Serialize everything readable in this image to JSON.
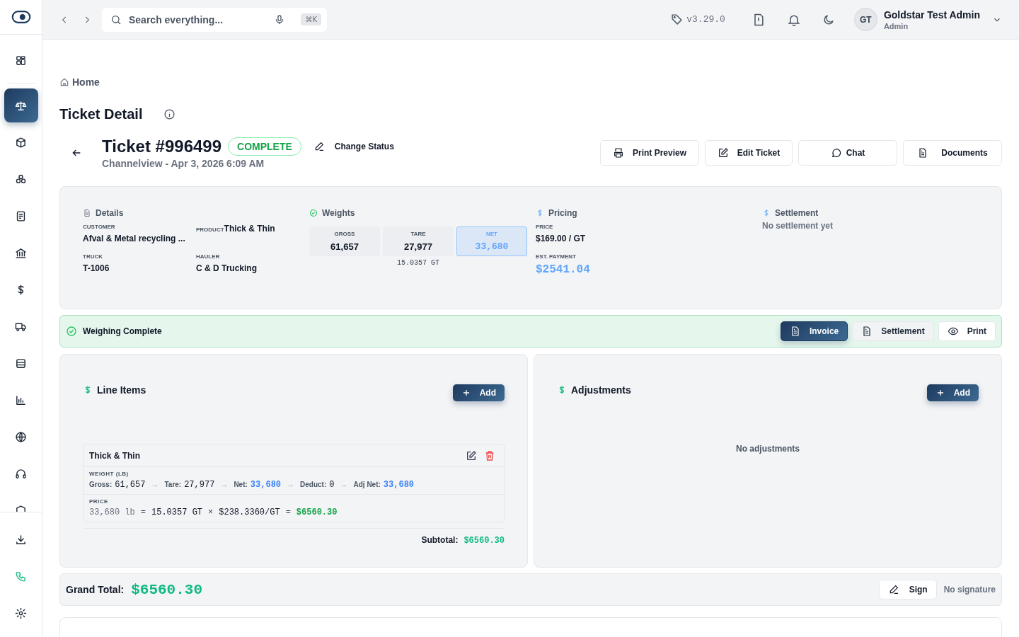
{
  "sidebar": {
    "top_items": [
      {
        "selected": false
      }
    ],
    "items": [
      {
        "selected": true
      },
      {
        "selected": false
      },
      {
        "selected": false
      },
      {
        "selected": false
      },
      {
        "selected": false
      },
      {
        "selected": false
      },
      {
        "selected": false
      },
      {
        "selected": false
      },
      {
        "selected": false
      },
      {
        "selected": false
      },
      {
        "selected": false
      },
      {
        "selected": false
      }
    ],
    "bottom_items": [
      {
        "selected": false
      },
      {
        "selected": false
      },
      {
        "selected": false
      }
    ]
  },
  "topbar": {
    "search": {
      "placeholder": "Search everything...",
      "shortcut": "⌘K"
    },
    "version": "v3.29.0",
    "user": {
      "initials": "GT",
      "name": "Goldstar Test Admin",
      "role": "Admin"
    }
  },
  "breadcrumb": "Home",
  "page_title": "Ticket Detail",
  "ticket": {
    "title": "Ticket #996499",
    "status": "COMPLETE",
    "change_status": "Change Status",
    "subtitle": "Channelview - Apr 3, 2026 6:09 AM"
  },
  "actions": [
    "Print Preview",
    "Edit Ticket",
    "Chat",
    "Documents"
  ],
  "details": {
    "heading": "Details",
    "fields": [
      {
        "label": "CUSTOMER",
        "value": "Afval & Metal recycling ..."
      },
      {
        "label": "PRODUCT",
        "value": "Thick & Thin"
      },
      {
        "label": "TRUCK",
        "value": "T-1006"
      },
      {
        "label": "HAULER",
        "value": "C & D Trucking"
      }
    ]
  },
  "weights": {
    "heading": "Weights",
    "cells": [
      {
        "label": "GROSS",
        "value": "61,657",
        "selected": false
      },
      {
        "label": "TARE",
        "value": "27,977",
        "selected": false
      },
      {
        "label": "NET",
        "value": "33,680",
        "selected": true
      }
    ],
    "conversion": "15.0357 GT"
  },
  "pricing": {
    "heading": "Pricing",
    "price_label": "PRICE",
    "price": "$169.00 / GT",
    "payment_label": "EST. PAYMENT",
    "payment": "$2541.04"
  },
  "settlement": {
    "heading": "Settlement",
    "text": "No settlement yet"
  },
  "banner": {
    "text": "Weighing Complete",
    "buttons": [
      {
        "label": "Invoice",
        "selected": true
      },
      {
        "label": "Settlement",
        "selected": false
      },
      {
        "label": "Print",
        "selected": false
      }
    ]
  },
  "line_items": {
    "heading": "Line Items",
    "add": "Add",
    "items": [
      {
        "name": "Thick & Thin",
        "weight_label": "WEIGHT (LB)",
        "steps": [
          {
            "kind": "value",
            "label": "Gross:",
            "value": "61,657",
            "highlight": false
          },
          {
            "kind": "arrow",
            "text": "→"
          },
          {
            "kind": "value",
            "label": "Tare:",
            "value": "27,977",
            "highlight": false
          },
          {
            "kind": "arrow",
            "text": "→"
          },
          {
            "kind": "value",
            "label": "Net:",
            "value": "33,680",
            "highlight": true
          },
          {
            "kind": "arrow",
            "text": "→"
          },
          {
            "kind": "value",
            "label": "Deduct:",
            "value": "0",
            "highlight": false
          },
          {
            "kind": "arrow",
            "text": "→"
          },
          {
            "kind": "value",
            "label": "Adj Net:",
            "value": "33,680",
            "highlight": true
          }
        ],
        "price_label": "PRICE",
        "formula": [
          {
            "kind": "muted",
            "text": "33,680 lb"
          },
          {
            "kind": "op",
            "text": "="
          },
          {
            "kind": "value",
            "text": "15.0357 GT"
          },
          {
            "kind": "op",
            "text": "×"
          },
          {
            "kind": "value",
            "text": "$238.3360/GT"
          },
          {
            "kind": "op",
            "text": "="
          },
          {
            "kind": "total",
            "text": "$6560.30"
          }
        ]
      }
    ],
    "subtotal_label": "Subtotal:",
    "subtotal": "$6560.30"
  },
  "adjustments": {
    "heading": "Adjustments",
    "add": "Add",
    "empty": "No adjustments"
  },
  "total": {
    "label": "Grand Total:",
    "value": "$6560.30",
    "sign": "Sign",
    "signature": "No signature"
  }
}
